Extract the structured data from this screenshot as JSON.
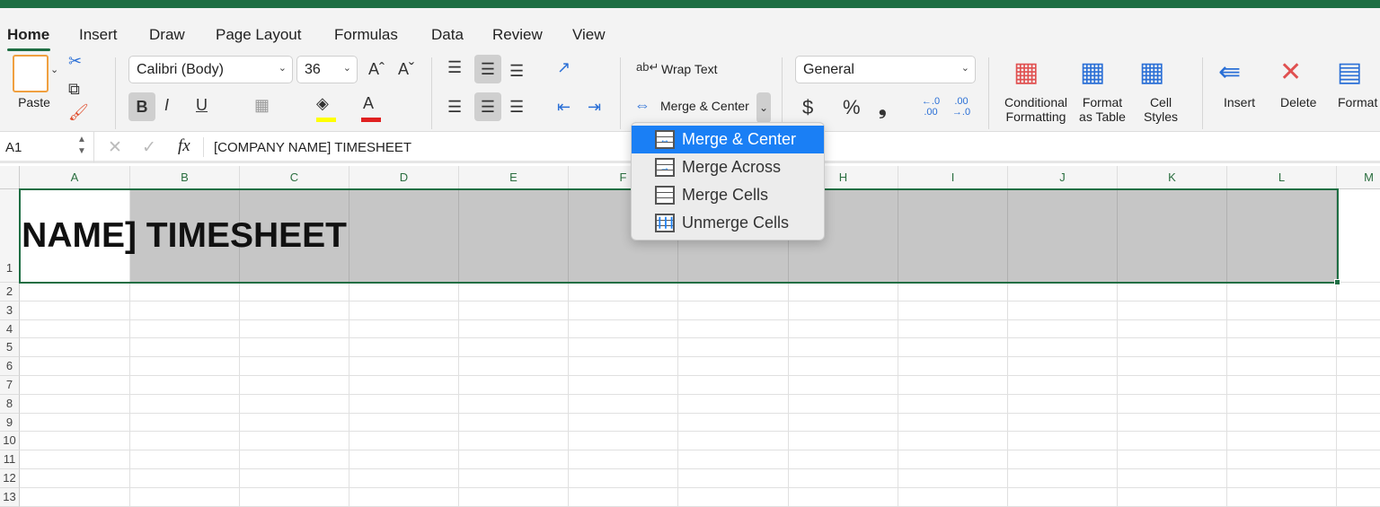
{
  "tabs": [
    "Home",
    "Insert",
    "Draw",
    "Page Layout",
    "Formulas",
    "Data",
    "Review",
    "View"
  ],
  "active_tab": "Home",
  "clipboard": {
    "paste_label": "Paste"
  },
  "font": {
    "name": "Calibri (Body)",
    "size": "36",
    "fill_color": "#ffff00",
    "font_color": "#e02020"
  },
  "alignment": {
    "wrap_text": "Wrap Text",
    "merge_center": "Merge & Center"
  },
  "number": {
    "format": "General",
    "currency": "$",
    "percent": "%",
    "comma": "❟",
    "inc_decimal": "←.0 .00",
    "dec_decimal": ".00 →.0"
  },
  "styles": {
    "conditional": "Conditional Formatting",
    "format_table": "Format as Table",
    "cell_styles": "Cell Styles"
  },
  "cells_group": {
    "insert": "Insert",
    "delete": "Delete",
    "format": "Format"
  },
  "formula_bar": {
    "name_box": "A1",
    "fx": "fx",
    "content": "[COMPANY NAME] TIMESHEET"
  },
  "columns": [
    "A",
    "B",
    "C",
    "D",
    "E",
    "F",
    "G",
    "H",
    "I",
    "J",
    "K",
    "L",
    "M"
  ],
  "rows": [
    "1",
    "2",
    "3",
    "4",
    "5",
    "6",
    "7",
    "8",
    "9",
    "10",
    "11",
    "12",
    "13"
  ],
  "cell_a1": "[COMPANY NAME] TIMESHEET",
  "merge_menu": [
    "Merge & Center",
    "Merge Across",
    "Merge Cells",
    "Unmerge Cells"
  ],
  "colors": {
    "accent": "#1e6e43",
    "selection_fill": "#c6c6c6",
    "menu_highlight": "#1a7ff5"
  }
}
